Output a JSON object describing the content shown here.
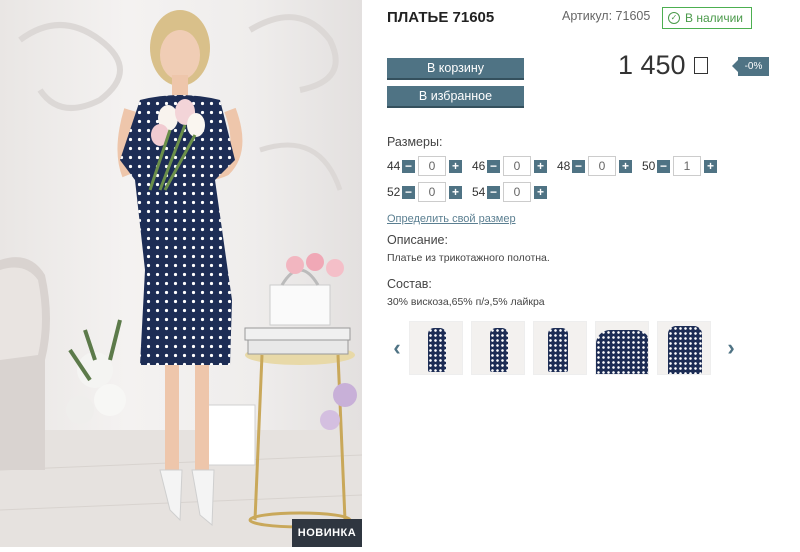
{
  "product": {
    "title": "ПЛАТЬЕ 71605",
    "sku": "Артикул: 71605",
    "stock": "В наличии",
    "badge": "НОВИНКА"
  },
  "buttons": {
    "cart": "В корзину",
    "favorites": "В избранное"
  },
  "price": {
    "value": "1 450",
    "discount": "-0%"
  },
  "sizes": {
    "label": "Размеры:",
    "rows": [
      [
        {
          "size": "44",
          "qty": "0"
        },
        {
          "size": "46",
          "qty": "0"
        },
        {
          "size": "48",
          "qty": "0"
        },
        {
          "size": "50",
          "qty": "1"
        }
      ],
      [
        {
          "size": "52",
          "qty": "0"
        },
        {
          "size": "54",
          "qty": "0"
        }
      ]
    ],
    "minus": "−",
    "plus": "+"
  },
  "size_link": "Определить свой размер",
  "description": {
    "label": "Описание:",
    "text": "Платье из трикотажного полотна."
  },
  "composition": {
    "label": "Состав:",
    "text": "30% вискоза,65% п/э,5% лайкра"
  },
  "gallery": {
    "prev_icon": "‹",
    "next_icon": "›",
    "thumbnails": [
      "thumb-front",
      "thumb-back",
      "thumb-side",
      "thumb-closeup",
      "thumb-detail"
    ]
  },
  "colors": {
    "accent": "#4f7384",
    "stock_green": "#4caf50",
    "dress_navy": "#1d2d55"
  }
}
